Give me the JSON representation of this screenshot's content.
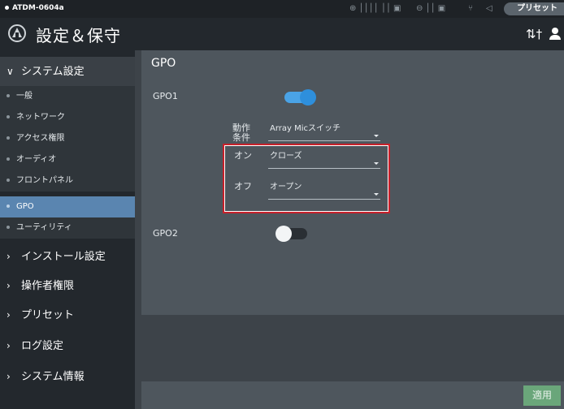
{
  "status_bar": {
    "device": "ATDM-0604a",
    "preset_label": "プリセット"
  },
  "title_bar": {
    "title": "設定＆保守",
    "logo_icon": "triangle-logo-icon",
    "sliders_icon": "sliders-icon",
    "user_icon": "user-icon"
  },
  "sidebar": {
    "sections": [
      {
        "label": "システム設定",
        "expanded": true
      },
      {
        "label": "インストール設定",
        "expanded": false
      },
      {
        "label": "操作者権限",
        "expanded": false
      },
      {
        "label": "プリセット",
        "expanded": false
      },
      {
        "label": "ログ設定",
        "expanded": false
      },
      {
        "label": "システム情報",
        "expanded": false
      }
    ],
    "system_items": [
      {
        "label": "一般",
        "active": false
      },
      {
        "label": "ネットワーク",
        "active": false
      },
      {
        "label": "アクセス権限",
        "active": false
      },
      {
        "label": "オーディオ",
        "active": false
      },
      {
        "label": "フロントパネル",
        "active": false
      },
      {
        "label": "GPO",
        "active": true
      },
      {
        "label": "ユーティリティ",
        "active": false
      }
    ]
  },
  "main": {
    "title": "GPO",
    "gpo1": {
      "label": "GPO1",
      "enabled": true,
      "condition_label": "動作条件",
      "condition_value": "Array Micスイッチ",
      "on_label": "オン",
      "on_value": "クローズ",
      "off_label": "オフ",
      "off_value": "オープン"
    },
    "gpo2": {
      "label": "GPO2",
      "enabled": false
    },
    "apply_label": "適用"
  },
  "colors": {
    "accent_blue": "#2e8fdc",
    "active_nav": "#5a85b0",
    "highlight_red": "#c8212b",
    "apply_green": "#6aa67a"
  }
}
